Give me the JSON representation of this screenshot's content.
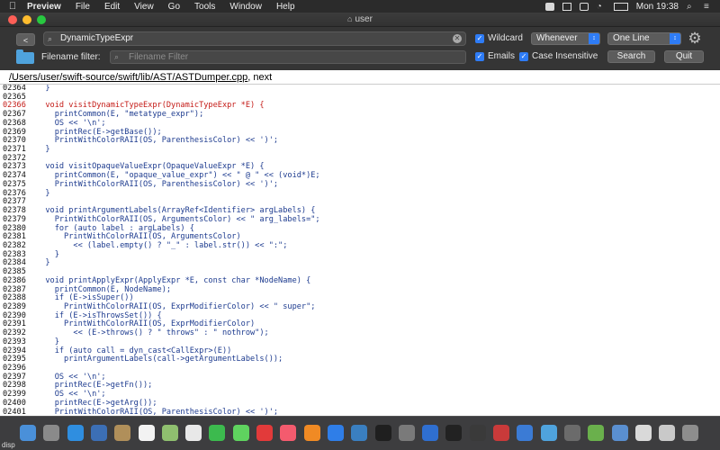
{
  "menubar": {
    "app": "Preview",
    "items": [
      "File",
      "Edit",
      "View",
      "Go",
      "Tools",
      "Window",
      "Help"
    ],
    "clock": "Mon 19:38"
  },
  "window": {
    "title": "user"
  },
  "toolbar": {
    "back_label": "<",
    "search_value": "DynamicTypeExpr",
    "wildcard_label": "Wildcard",
    "whenever_value": "Whenever",
    "oneline_value": "One Line",
    "filename_filter_label": "Filename filter:",
    "filename_filter_placeholder": "Filename Filter",
    "emails_label": "Emails",
    "case_label": "Case Insensitive",
    "search_button": "Search",
    "quit_button": "Quit"
  },
  "pathbar": {
    "path": "/Users/user/swift-source/swift/lib/AST/ASTDumper.cpp",
    "suffix": ", next"
  },
  "code": {
    "lines": [
      {
        "n": "02364",
        "t": "  }"
      },
      {
        "n": "02365",
        "t": ""
      },
      {
        "n": "02366",
        "t": "  void visitDynamicTypeExpr(DynamicTypeExpr *E) {",
        "hl": true
      },
      {
        "n": "02367",
        "t": "    printCommon(E, \"metatype_expr\");"
      },
      {
        "n": "02368",
        "t": "    OS << '\\n';"
      },
      {
        "n": "02369",
        "t": "    printRec(E->getBase());"
      },
      {
        "n": "02370",
        "t": "    PrintWithColorRAII(OS, ParenthesisColor) << ')';"
      },
      {
        "n": "02371",
        "t": "  }"
      },
      {
        "n": "02372",
        "t": ""
      },
      {
        "n": "02373",
        "t": "  void visitOpaqueValueExpr(OpaqueValueExpr *E) {"
      },
      {
        "n": "02374",
        "t": "    printCommon(E, \"opaque_value_expr\") << \" @ \" << (void*)E;"
      },
      {
        "n": "02375",
        "t": "    PrintWithColorRAII(OS, ParenthesisColor) << ')';"
      },
      {
        "n": "02376",
        "t": "  }"
      },
      {
        "n": "02377",
        "t": ""
      },
      {
        "n": "02378",
        "t": "  void printArgumentLabels(ArrayRef<Identifier> argLabels) {"
      },
      {
        "n": "02379",
        "t": "    PrintWithColorRAII(OS, ArgumentsColor) << \" arg_labels=\";"
      },
      {
        "n": "02380",
        "t": "    for (auto label : argLabels) {"
      },
      {
        "n": "02381",
        "t": "      PrintWithColorRAII(OS, ArgumentsColor)"
      },
      {
        "n": "02382",
        "t": "        << (label.empty() ? \"_\" : label.str()) << \":\";"
      },
      {
        "n": "02383",
        "t": "    }"
      },
      {
        "n": "02384",
        "t": "  }"
      },
      {
        "n": "02385",
        "t": ""
      },
      {
        "n": "02386",
        "t": "  void printApplyExpr(ApplyExpr *E, const char *NodeName) {"
      },
      {
        "n": "02387",
        "t": "    printCommon(E, NodeName);"
      },
      {
        "n": "02388",
        "t": "    if (E->isSuper())"
      },
      {
        "n": "02389",
        "t": "      PrintWithColorRAII(OS, ExprModifierColor) << \" super\";"
      },
      {
        "n": "02390",
        "t": "    if (E->isThrowsSet()) {"
      },
      {
        "n": "02391",
        "t": "      PrintWithColorRAII(OS, ExprModifierColor)"
      },
      {
        "n": "02392",
        "t": "        << (E->throws() ? \" throws\" : \" nothrow\");"
      },
      {
        "n": "02393",
        "t": "    }"
      },
      {
        "n": "02394",
        "t": "    if (auto call = dyn_cast<CallExpr>(E))"
      },
      {
        "n": "02395",
        "t": "      printArgumentLabels(call->getArgumentLabels());"
      },
      {
        "n": "02396",
        "t": ""
      },
      {
        "n": "02397",
        "t": "    OS << '\\n';"
      },
      {
        "n": "02398",
        "t": "    printRec(E->getFn());"
      },
      {
        "n": "02399",
        "t": "    OS << '\\n';"
      },
      {
        "n": "02400",
        "t": "    printRec(E->getArg());"
      },
      {
        "n": "02401",
        "t": "    PrintWithColorRAII(OS, ParenthesisColor) << ')';"
      }
    ]
  },
  "dock": {
    "label": "disp",
    "icons": [
      {
        "name": "finder-icon",
        "color": "#4a90d9"
      },
      {
        "name": "launchpad-icon",
        "color": "#8a8a8a"
      },
      {
        "name": "safari-icon",
        "color": "#2f8ee0"
      },
      {
        "name": "photos-icon",
        "color": "#3c6fb5"
      },
      {
        "name": "notes-icon",
        "color": "#b08f5a"
      },
      {
        "name": "calendar-icon",
        "color": "#f2f2f2"
      },
      {
        "name": "maps-icon",
        "color": "#8fbf6f"
      },
      {
        "name": "textedit-icon",
        "color": "#e8e8e8"
      },
      {
        "name": "facetime-icon",
        "color": "#3cba4e"
      },
      {
        "name": "messages-icon",
        "color": "#5fd35f"
      },
      {
        "name": "noentry-icon",
        "color": "#e23a3a"
      },
      {
        "name": "music-icon",
        "color": "#f45b6e"
      },
      {
        "name": "books-icon",
        "color": "#f08a24"
      },
      {
        "name": "appstore-icon",
        "color": "#2f7ee8"
      },
      {
        "name": "network-icon",
        "color": "#3a7fc0"
      },
      {
        "name": "terminal-icon",
        "color": "#1f1f1f"
      },
      {
        "name": "sysprefs-icon",
        "color": "#7a7a7a"
      },
      {
        "name": "xcode-icon",
        "color": "#2f6fd0"
      },
      {
        "name": "stocks-icon",
        "color": "#222222"
      },
      {
        "name": "activity-icon",
        "color": "#3a3a3a"
      },
      {
        "name": "screenshot-icon",
        "color": "#c93a3a"
      },
      {
        "name": "swift-icon",
        "color": "#3b7bd5"
      },
      {
        "name": "folder-blue-icon",
        "color": "#4fa3dd"
      },
      {
        "name": "gear-app-icon",
        "color": "#6b6b6b"
      },
      {
        "name": "android-icon",
        "color": "#6ab04c"
      },
      {
        "name": "window-icon",
        "color": "#5a8fd0"
      },
      {
        "name": "document-icon",
        "color": "#d9d9d9"
      },
      {
        "name": "document2-icon",
        "color": "#c9c9c9"
      },
      {
        "name": "trash-icon",
        "color": "#8d8d8d"
      }
    ]
  }
}
